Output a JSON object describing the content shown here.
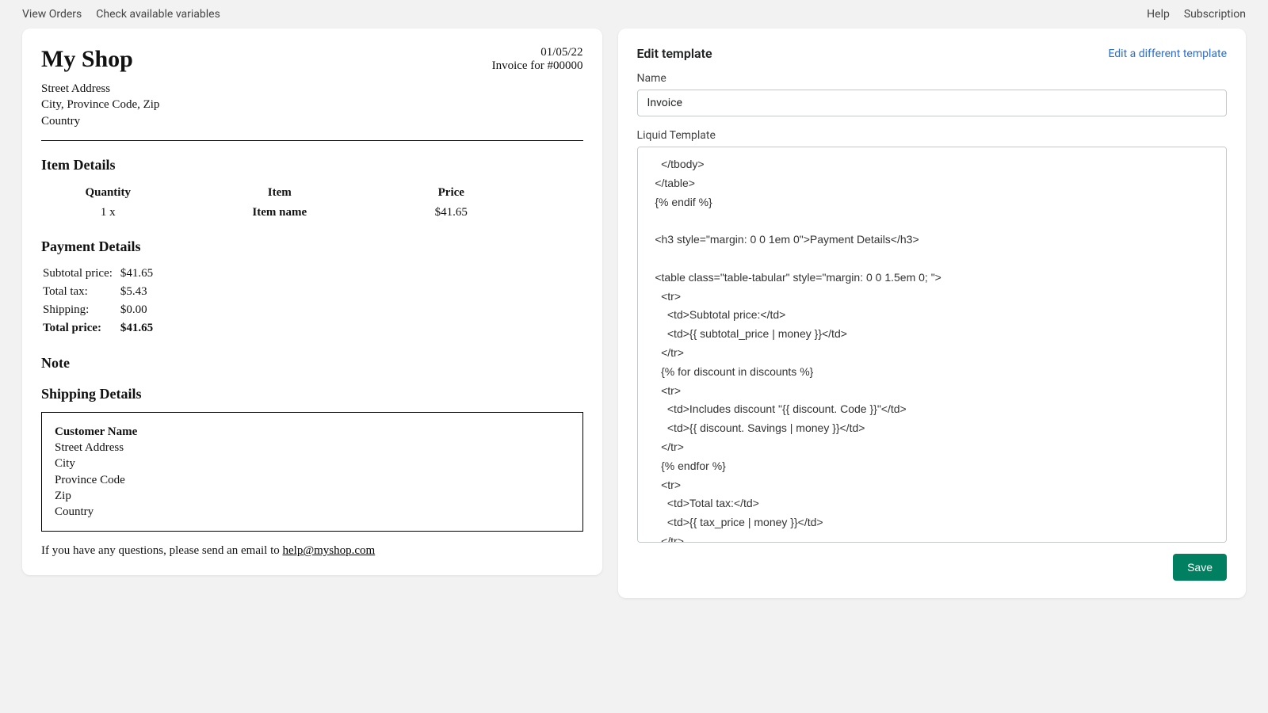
{
  "topbar": {
    "left": [
      "View Orders",
      "Check available variables"
    ],
    "right": [
      "Help",
      "Subscription"
    ]
  },
  "preview": {
    "shop_name": "My Shop",
    "date": "01/05/22",
    "invoice_for": "Invoice for #00000",
    "address_line1": "Street Address",
    "address_line2": "City, Province Code, Zip",
    "address_line3": "Country",
    "item_details_heading": "Item Details",
    "items_header": {
      "qty": "Quantity",
      "item": "Item",
      "price": "Price"
    },
    "items": [
      {
        "qty": "1 x",
        "item": "Item name",
        "price": "$41.65"
      }
    ],
    "payment_heading": "Payment Details",
    "payments": {
      "subtotal_label": "Subtotal price:",
      "subtotal_value": "$41.65",
      "tax_label": "Total tax:",
      "tax_value": "$5.43",
      "shipping_label": "Shipping:",
      "shipping_value": "$0.00",
      "total_label": "Total price:",
      "total_value": "$41.65"
    },
    "note_heading": "Note",
    "shipping_heading": "Shipping Details",
    "shipping": {
      "customer": "Customer Name",
      "line1": "Street Address",
      "line2": "City",
      "line3": "Province Code",
      "line4": "Zip",
      "line5": "Country"
    },
    "footer_prefix": "If you have any questions, please send an email to ",
    "footer_email": "help@myshop.com"
  },
  "editor": {
    "title": "Edit template",
    "alt_link": "Edit a different template",
    "name_label": "Name",
    "name_value": "Invoice",
    "template_label": "Liquid Template",
    "save_label": "Save",
    "code": "    </tbody>\n  </table>\n  {% endif %}\n\n  <h3 style=\"margin: 0 0 1em 0\">Payment Details</h3>\n\n  <table class=\"table-tabular\" style=\"margin: 0 0 1.5em 0; \">\n    <tr>\n      <td>Subtotal price:</td>\n      <td>{{ subtotal_price | money }}</td>\n    </tr>\n    {% for discount in discounts %}\n    <tr>\n      <td>Includes discount \"{{ discount. Code }}\"</td>\n      <td>{{ discount. Savings | money }}</td>\n    </tr>\n    {% endfor %}\n    <tr>\n      <td>Total tax:</td>\n      <td>{{ tax_price | money }}</td>\n    </tr>\n"
  }
}
